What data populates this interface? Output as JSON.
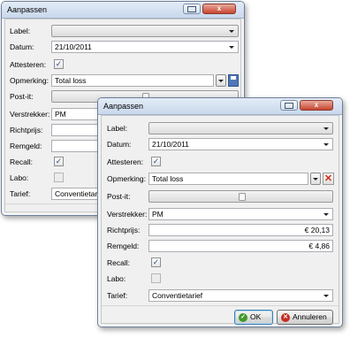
{
  "back_window": {
    "title": "Aanpassen",
    "fields": {
      "label": {
        "label": "Label:",
        "value": ""
      },
      "datum": {
        "label": "Datum:",
        "value": "21/10/2011"
      },
      "attesteren": {
        "label": "Attesteren:",
        "checked": true
      },
      "opmerking": {
        "label": "Opmerking:",
        "value": "Total loss"
      },
      "postit": {
        "label": "Post-it:",
        "value": ""
      },
      "verstrekker": {
        "label": "Verstrekker:",
        "value": "PM"
      },
      "richtprijs": {
        "label": "Richtprijs:",
        "value": ""
      },
      "remgeld": {
        "label": "Remgeld:",
        "value": ""
      },
      "recall": {
        "label": "Recall:",
        "checked": true
      },
      "labo": {
        "label": "Labo:",
        "checked": false
      },
      "tarief": {
        "label": "Tarief:",
        "value": "Conventietarief"
      }
    }
  },
  "front_window": {
    "title": "Aanpassen",
    "fields": {
      "label": {
        "label": "Label:",
        "value": ""
      },
      "datum": {
        "label": "Datum:",
        "value": "21/10/2011"
      },
      "attesteren": {
        "label": "Attesteren:",
        "checked": true
      },
      "opmerking": {
        "label": "Opmerking:",
        "value": "Total loss"
      },
      "postit": {
        "label": "Post-it:",
        "value": ""
      },
      "verstrekker": {
        "label": "Verstrekker:",
        "value": "PM"
      },
      "richtprijs": {
        "label": "Richtprijs:",
        "value": "€ 20,13"
      },
      "remgeld": {
        "label": "Remgeld:",
        "value": "€ 4,86"
      },
      "recall": {
        "label": "Recall:",
        "checked": true
      },
      "labo": {
        "label": "Labo:",
        "checked": false
      },
      "tarief": {
        "label": "Tarief:",
        "value": "Conventietarief"
      }
    },
    "buttons": {
      "ok": "OK",
      "cancel": "Annuleren"
    }
  },
  "glyphs": {
    "check": "✓",
    "close": "x",
    "delete": "✕",
    "ok": "✓",
    "cancel": "✕"
  },
  "icons": [
    "restore-icon",
    "close-icon",
    "dropdown-arrow-icon",
    "save-icon",
    "delete-icon",
    "postit-icon",
    "ok-icon",
    "cancel-icon"
  ],
  "colors": {
    "titlebar": "#c9d8ec",
    "close_button": "#c7452f",
    "ok_icon": "#3f9a2b",
    "cancel_icon": "#c52d22"
  }
}
